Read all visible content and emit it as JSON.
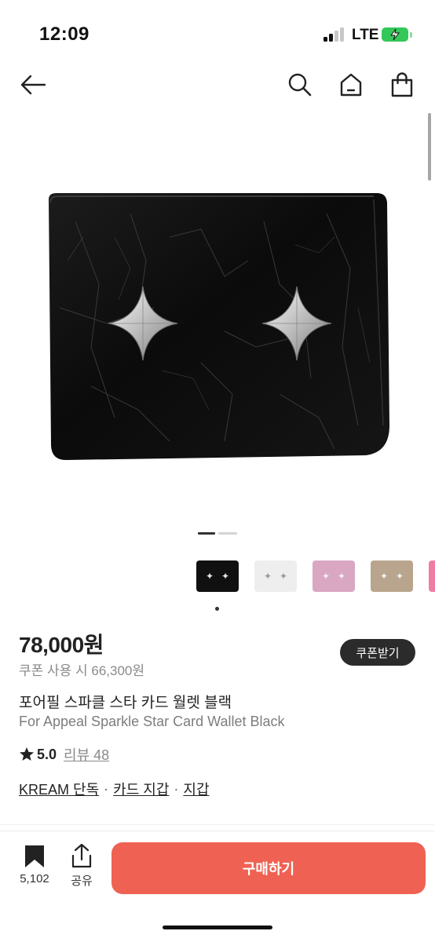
{
  "status_bar": {
    "time": "12:09",
    "network": "LTE",
    "signal_bars_active": 2,
    "signal_bars_total": 4,
    "battery_state": "charging",
    "battery_color": "#34c759"
  },
  "nav": {
    "back_icon": "arrow-left-icon",
    "search_icon": "search-icon",
    "home_icon": "home-icon",
    "cart_icon": "shopping-bag-icon"
  },
  "gallery": {
    "page_count": 2,
    "current_page": 1,
    "thumbnails": [
      {
        "color_name": "black",
        "bg": "#101010",
        "star_color": "#e6e6e6",
        "selected": true
      },
      {
        "color_name": "white",
        "bg": "#eeeeee",
        "star_color": "#9a9a9a",
        "selected": false
      },
      {
        "color_name": "pink",
        "bg": "#d9a7c2",
        "star_color": "#f2f2f2",
        "selected": false
      },
      {
        "color_name": "beige",
        "bg": "#b9a58d",
        "star_color": "#f2f2f2",
        "selected": false
      },
      {
        "color_name": "hot-pink",
        "bg": "#ef7da2",
        "star_color": "#f2f2f2",
        "selected": false
      }
    ]
  },
  "product": {
    "price": "78,000원",
    "coupon_price": "쿠폰 사용 시 66,300원",
    "coupon_button": "쿠폰받기",
    "title_ko": "포어필 스파클 스타 카드 월렛 블랙",
    "title_en": "For Appeal Sparkle Star Card Wallet Black",
    "rating": "5.0",
    "review_label": "리뷰 48",
    "categories": [
      "KREAM 단독",
      "카드 지갑",
      "지갑"
    ],
    "category_separator": "·"
  },
  "bottom_bar": {
    "bookmark_count": "5,102",
    "share_label": "공유",
    "buy_label": "구매하기",
    "buy_color": "#ef6253"
  }
}
